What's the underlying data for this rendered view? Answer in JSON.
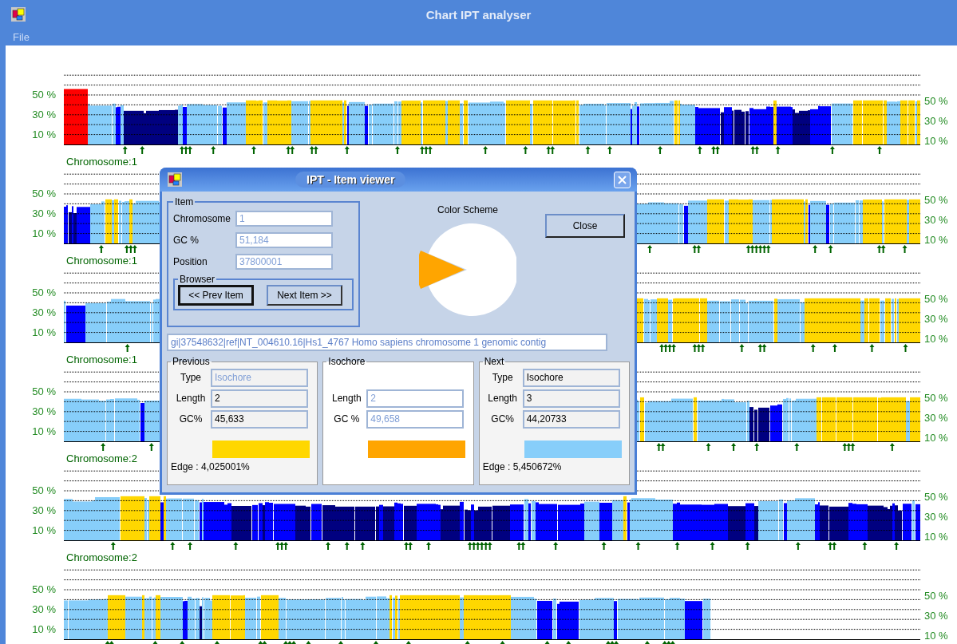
{
  "window": {
    "title": "Chart IPT analyser"
  },
  "menu": [
    {
      "label": "File",
      "disabled": true
    }
  ],
  "strips": [
    {
      "chromosome": "Chromosome:1",
      "left_ticks": [
        "50 %",
        "30 %",
        "10 %"
      ],
      "right_ticks": [
        "50 %",
        "30 %",
        "10 %"
      ]
    },
    {
      "chromosome": "Chromosome:1",
      "left_ticks": [
        "50 %",
        "30 %",
        "10 %"
      ],
      "right_ticks": [
        "50 %",
        "30 %",
        "10 %"
      ]
    },
    {
      "chromosome": "Chromosome:1",
      "left_ticks": [
        "50 %",
        "30 %",
        "10 %"
      ],
      "right_ticks": [
        "50 %",
        "30 %",
        "10 %"
      ]
    },
    {
      "chromosome": "Chromosome:2",
      "left_ticks": [
        "50 %",
        "30 %",
        "10 %"
      ],
      "right_ticks": [
        "50 %",
        "30 %",
        "10 %"
      ]
    },
    {
      "chromosome": "Chromosome:2",
      "left_ticks": [
        "50 %",
        "30 %",
        "10 %"
      ],
      "right_ticks": [
        "50 %",
        "30 %",
        "10 %"
      ]
    },
    {
      "left_ticks": [
        "50 %",
        "30 %",
        "10 %"
      ],
      "right_ticks": [
        "50 %",
        "30 %",
        "10 %"
      ]
    }
  ],
  "item_viewer": {
    "title": "IPT - Item viewer",
    "item_group": {
      "legend": "Item",
      "fields": [
        {
          "label": "Chromosome",
          "value": "1",
          "disabled": true
        },
        {
          "label": "GC %",
          "value": "51,184",
          "disabled": true
        },
        {
          "label": "Position",
          "value": "37800001",
          "disabled": true
        }
      ]
    },
    "browser_group": {
      "legend": "Browser",
      "buttons": [
        {
          "label": "<< Prev Item",
          "default": true
        },
        {
          "label": "Next Item >>",
          "default": false
        }
      ]
    },
    "color_scheme_label": "Color Scheme",
    "close_button": "Close",
    "description": "gi|37548632|ref|NT_004610.16|Hs1_4767 Homo sapiens chromosome 1 genomic contig",
    "panels": [
      {
        "legend": "Previous",
        "highlighted": false,
        "color": "#ffd700",
        "edge": "Edge : 4,025001%",
        "fields": [
          {
            "label": "Type",
            "value": "Isochore",
            "disabled": true
          },
          {
            "label": "Length",
            "value": "2",
            "disabled": false
          },
          {
            "label": "GC%",
            "value": "45,633",
            "disabled": false
          }
        ]
      },
      {
        "legend": "Isochore",
        "highlighted": true,
        "color": "#ffa500",
        "fields": [
          {
            "label": "Length",
            "value": "2",
            "disabled": true
          },
          {
            "label": "GC %",
            "value": "49,658",
            "disabled": true
          }
        ]
      },
      {
        "legend": "Next",
        "highlighted": false,
        "color": "#87cefa",
        "edge": "Edge : 5,450672%",
        "fields": [
          {
            "label": "Type",
            "value": "Isochore",
            "disabled": false
          },
          {
            "label": "Length",
            "value": "3",
            "disabled": false
          },
          {
            "label": "GC%",
            "value": "44,20733",
            "disabled": false
          }
        ]
      }
    ]
  }
}
